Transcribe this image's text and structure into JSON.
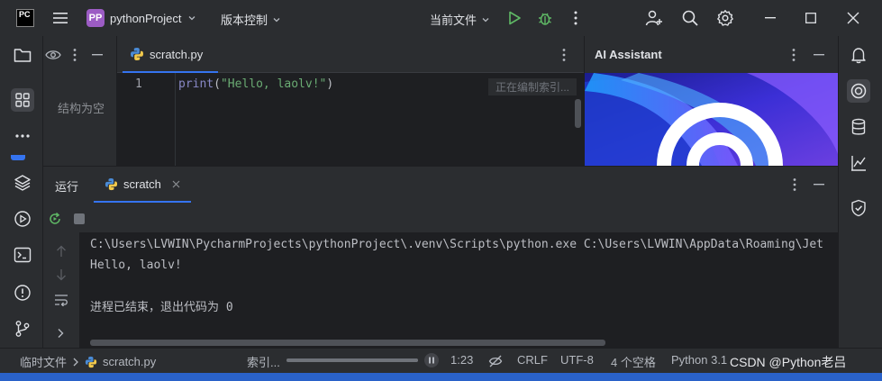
{
  "titlebar": {
    "app_logo": "PC",
    "project_badge": "PP",
    "project_name": "pythonProject",
    "vcs_menu": "版本控制",
    "run_config": "当前文件"
  },
  "structure_panel": {
    "empty_text": "结构为空"
  },
  "editor": {
    "tab_label": "scratch.py",
    "line_numbers": [
      "1"
    ],
    "code_func": "print",
    "code_open": "(",
    "code_string": "\"Hello, laolv!\"",
    "code_close": ")",
    "indexing_hint": "正在编制索引..."
  },
  "ai_assistant": {
    "title": "AI Assistant"
  },
  "run_panel": {
    "title": "运行",
    "tab_label": "scratch",
    "console_lines": [
      "C:\\Users\\LVWIN\\PycharmProjects\\pythonProject\\.venv\\Scripts\\python.exe C:\\Users\\LVWIN\\AppData\\Roaming\\Jet",
      "Hello, laolv!",
      "",
      "进程已结束，退出代码为 0"
    ]
  },
  "statusbar": {
    "breadcrumb_root": "临时文件",
    "breadcrumb_file": "scratch.py",
    "indexing_label": "索引...",
    "position": "1:23",
    "line_ending": "CRLF",
    "encoding": "UTF-8",
    "indent": "4 个空格",
    "interpreter": "Python 3.1",
    "watermark": "CSDN @Python老吕"
  },
  "colors": {
    "accent": "#3574f0",
    "run_green": "#5fb865",
    "keyword": "#8888c6",
    "string": "#6aab73"
  }
}
